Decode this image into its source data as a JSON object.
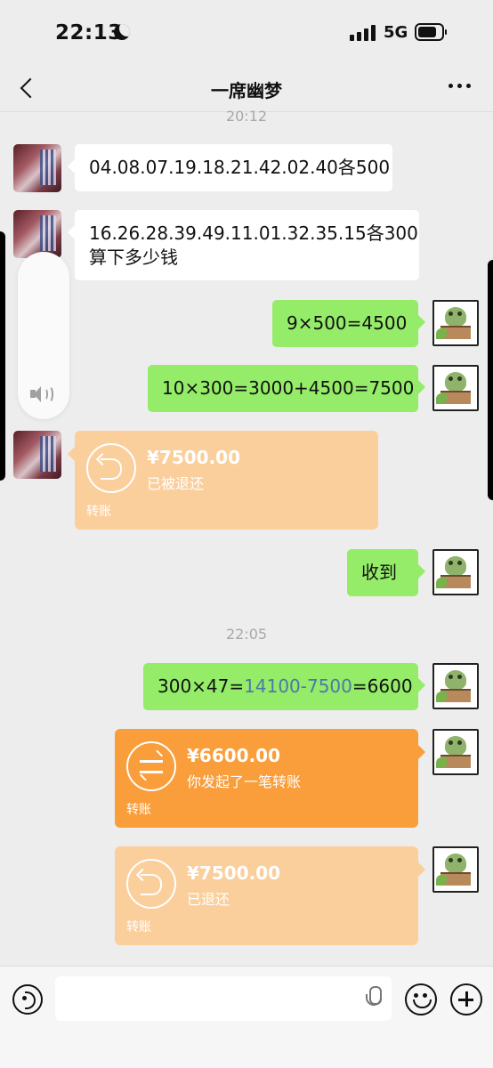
{
  "status_bar": {
    "time": "22:13",
    "network": "5G"
  },
  "chat": {
    "title": "一席幽梦"
  },
  "timestamps": [
    "20:12",
    "22:05"
  ],
  "messages": {
    "m1": "04.08.07.19.18.21.42.02.40各500",
    "m2_line1": "16.26.28.39.49.11.01.32.35.15各300",
    "m2_line2": "算下多少钱",
    "m3": "9×500=4500",
    "m4": "10×300=3000+4500=7500",
    "m5": "收到",
    "m6": {
      "pre": "300×47=",
      "blue": "14100-7500",
      "post": "=6600"
    }
  },
  "transfers": [
    {
      "amount": "¥7500.00",
      "status": "已被退还",
      "label": "转账"
    },
    {
      "amount": "¥6600.00",
      "status": "你发起了一笔转账",
      "label": "转账"
    },
    {
      "amount": "¥7500.00",
      "status": "已退还",
      "label": "转账"
    }
  ],
  "input": {
    "placeholder": ""
  },
  "icons": {
    "back": "back-chevron-icon",
    "more": "more-dots-icon",
    "voice": "voice-input-icon",
    "mic": "microphone-icon",
    "emoji": "emoji-icon",
    "plus": "plus-icon",
    "speaker": "speaker-volume-icon"
  },
  "colors": {
    "background": "#ededed",
    "bubble_sent": "#95ec69",
    "bubble_received": "#ffffff",
    "transfer_done": "#fbcf9c",
    "transfer_pending": "#fa9d3b",
    "formula_highlight": "#4c78a8"
  }
}
